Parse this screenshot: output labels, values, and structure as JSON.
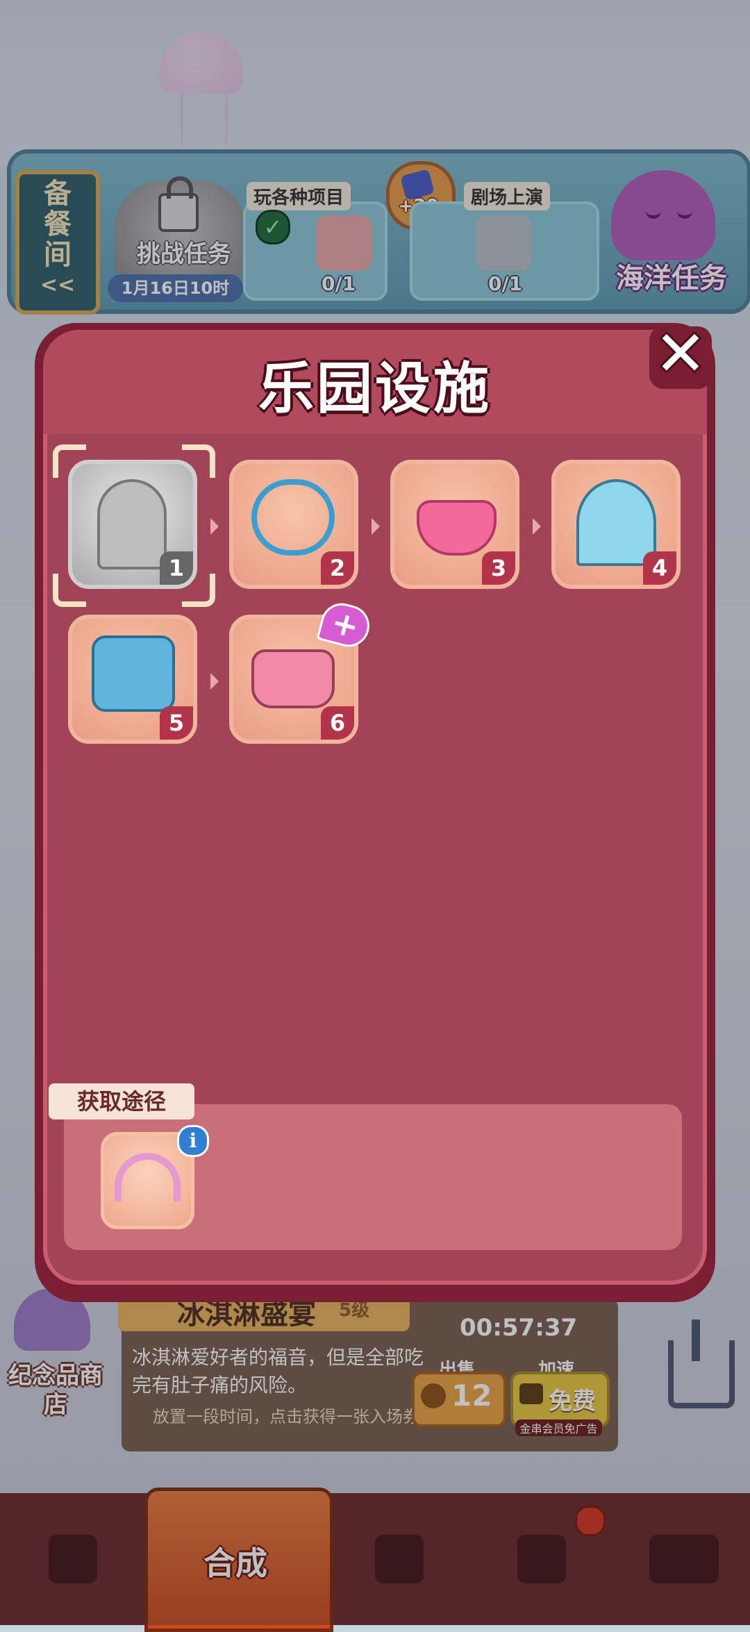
{
  "top": {
    "spare_room": "备餐间",
    "spare_arrow": "<<",
    "challenge_label": "挑战任务",
    "challenge_date": "1月16日10时",
    "task1_title": "玩各种项目",
    "task1_progress": "0/1",
    "reward": "+20",
    "task2_title": "剧场上演",
    "task2_progress": "0/1",
    "ocean_task": "海洋任务"
  },
  "modal": {
    "title": "乐园设施",
    "close": "✕",
    "facilities": [
      {
        "num": "1",
        "state": "locked"
      },
      {
        "num": "2",
        "state": "unlocked"
      },
      {
        "num": "3",
        "state": "unlocked"
      },
      {
        "num": "4",
        "state": "unlocked"
      },
      {
        "num": "5",
        "state": "unlocked"
      },
      {
        "num": "6",
        "state": "unlocked"
      }
    ],
    "plus": "+",
    "source_title": "获取途径",
    "info": "i"
  },
  "bottom_info": {
    "title": "冰淇淋盛宴",
    "level": "5级",
    "timer": "00:57:37",
    "desc": "冰淇淋爱好者的福音，但是全部吃完有肚子痛的风险。",
    "hint": "放置一段时间，点击获得一张入场券。",
    "sell_label": "出售",
    "sell_value": "12",
    "speed_label": "加速",
    "speed_value": "免费",
    "vip_note": "金串会员免广告"
  },
  "souvenir": "纪念品商店",
  "nav": {
    "merge": "合成"
  },
  "colors": {
    "modal_bg": "#a24458",
    "modal_border": "#7a1f33",
    "tile": "#f7c4aa",
    "badge": "#b2344a",
    "plus_badge": "#d75cd3"
  }
}
